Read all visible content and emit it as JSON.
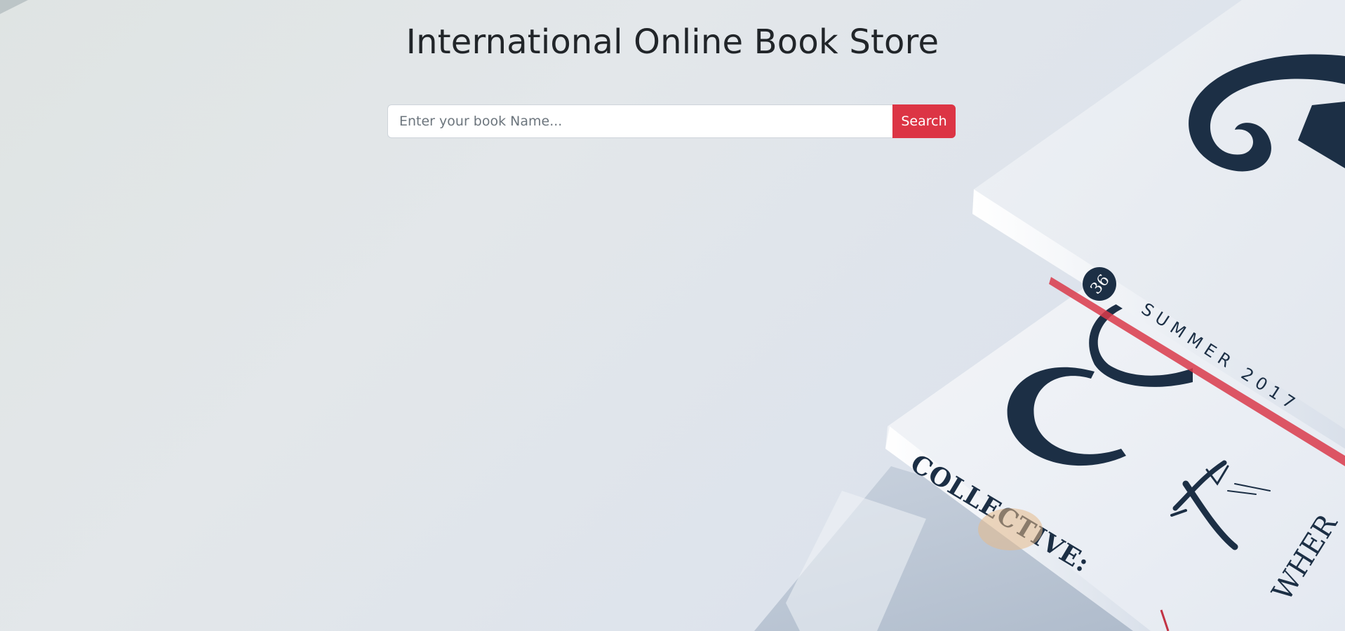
{
  "page": {
    "title": "International Online Book Store"
  },
  "search": {
    "placeholder": "Enter your book Name...",
    "value": "",
    "button_label": "Search"
  },
  "background": {
    "subject": "stack of magazines photo",
    "magazine_top": {
      "issue_number": "36",
      "spine_text": "SUMMER 2017"
    },
    "magazine_middle": {
      "spine_text": "COLLECTIVE:",
      "cover_partial_text": "WHER"
    }
  },
  "colors": {
    "search_button": "#dc3545",
    "title_text": "#212529",
    "magazine_ink": "#1c2f45"
  }
}
